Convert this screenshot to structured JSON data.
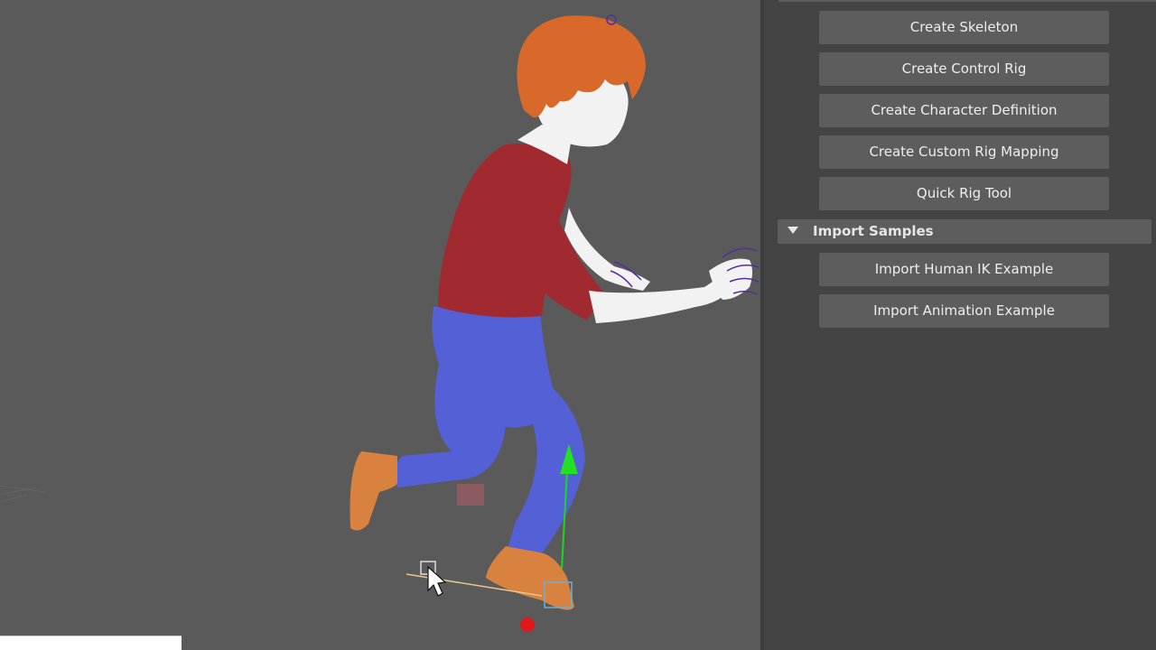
{
  "rig_panel": {
    "buttons": [
      "Create Skeleton",
      "Create Control Rig",
      "Create Character Definition",
      "Create Custom Rig Mapping",
      "Quick Rig Tool"
    ]
  },
  "import_samples": {
    "title": "Import Samples",
    "buttons": [
      "Import Human IK Example",
      "Import Animation Example"
    ]
  },
  "colors": {
    "viewport_bg": "#5a5a5a",
    "panel_bg": "#444444",
    "button_bg": "#5d5d5d",
    "hair": "#d8692b",
    "shirt": "#a12a30",
    "pants": "#5460d6",
    "skin": "#f2f2f2",
    "feet": "#d9823f"
  },
  "icons": {
    "collapse": "triangle-down-icon",
    "cursor": "mouse-pointer-icon",
    "manipulator": "move-manipulator-icon"
  }
}
